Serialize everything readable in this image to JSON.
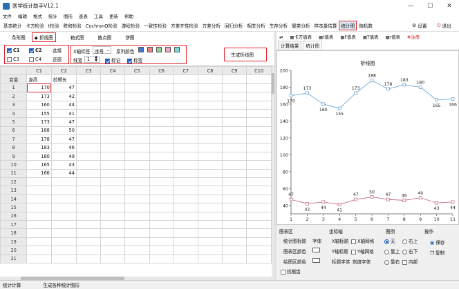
{
  "window": {
    "title": "医学统计助手V12.1",
    "minimize": "—",
    "maximize": "☐",
    "close": "✕"
  },
  "menu": [
    "文件",
    "编辑",
    "格式",
    "统计",
    "图形",
    "查表",
    "工具",
    "更新",
    "帮助"
  ],
  "modules": [
    "基本统计",
    "卡方检验",
    "t检验",
    "秩和检验",
    "CochranQ检验",
    "游程检验",
    "一致性检验",
    "方差齐性检验",
    "方差分析",
    "回归分析",
    "相关分析",
    "生存分析",
    "聚类分析",
    "样本量估算",
    "统计图",
    "随机数"
  ],
  "active_module": "统计图",
  "top_right": {
    "settings": "设置",
    "exit": "退出"
  },
  "left_tabs": [
    "条形图",
    "折线图",
    "箱式图",
    "散点图",
    "饼图"
  ],
  "active_left_tab": "折线图",
  "controls": {
    "c1": "C1",
    "c2": "C2",
    "c3": "C3",
    "c4": "C4",
    "select_btn": "选择",
    "restore_btn": "还原",
    "xaxis_label": "X轴标签",
    "xaxis_value": "序号",
    "series_color": "系列颜色",
    "colors": [
      "#3a7bd5",
      "#f08080",
      "#8fd18f",
      "#f4a6c8",
      "#7fd8d8"
    ],
    "linewidth_label": "线宽",
    "linewidth_value": "1",
    "marker": "标记",
    "label": "标签",
    "generate_btn": "生成折线图"
  },
  "grid": {
    "columns": [
      "",
      "C1",
      "C2",
      "C3",
      "C4",
      "C5",
      "C6",
      "C7",
      "C8",
      "C9",
      "C10"
    ],
    "header_row": [
      "变量",
      "身高",
      "前臂长"
    ],
    "rows": [
      {
        "n": "1",
        "c1": "170",
        "c2": "47"
      },
      {
        "n": "2",
        "c1": "173",
        "c2": "42"
      },
      {
        "n": "3",
        "c1": "160",
        "c2": "44"
      },
      {
        "n": "4",
        "c1": "155",
        "c2": "41"
      },
      {
        "n": "5",
        "c1": "173",
        "c2": "47"
      },
      {
        "n": "6",
        "c1": "188",
        "c2": "50"
      },
      {
        "n": "7",
        "c1": "178",
        "c2": "47"
      },
      {
        "n": "8",
        "c1": "183",
        "c2": "46"
      },
      {
        "n": "9",
        "c1": "180",
        "c2": "49"
      },
      {
        "n": "10",
        "c1": "165",
        "c2": "43"
      },
      {
        "n": "11",
        "c1": "166",
        "c2": "44"
      },
      {
        "n": "12",
        "c1": "",
        "c2": ""
      },
      {
        "n": "13",
        "c1": "",
        "c2": ""
      },
      {
        "n": "14",
        "c1": "",
        "c2": ""
      },
      {
        "n": "15",
        "c1": "",
        "c2": ""
      },
      {
        "n": "16",
        "c1": "",
        "c2": ""
      },
      {
        "n": "17",
        "c1": "",
        "c2": ""
      },
      {
        "n": "18",
        "c1": "",
        "c2": ""
      },
      {
        "n": "19",
        "c1": "",
        "c2": ""
      },
      {
        "n": "20",
        "c1": "",
        "c2": ""
      },
      {
        "n": "21",
        "c1": "",
        "c2": ""
      }
    ]
  },
  "right_toolbar": [
    "卡方值表",
    "t值表",
    "F值表",
    "T值表",
    "r值表",
    "注册"
  ],
  "right_tabs": [
    "计算结果",
    "统计图"
  ],
  "active_right_tab": "统计图",
  "options": {
    "chart_area": {
      "title": "图表区",
      "chart_title": "统计图标题",
      "font": "字体",
      "chart_bg": "图表区颜色",
      "plot_bg": "绘图区颜色",
      "antialias": "抗锯齿"
    },
    "axes": {
      "title": "坐标轴",
      "xtitle": "X轴标题",
      "ytitle": "Y轴标题",
      "xgrid": "X轴网格",
      "ygrid": "Y轴网格",
      "title_font": "标题字体",
      "tick_font": "刻度字体"
    },
    "legend": {
      "title": "图例",
      "none": "无",
      "top_right": "右上",
      "right": "靠上",
      "bottom_right": "右下",
      "left": "靠右",
      "inside": "内部"
    },
    "ops": {
      "title": "操作",
      "save": "保存",
      "copy": "复制"
    }
  },
  "status": {
    "left": "统计计算",
    "right": "生成各种统计图形"
  },
  "chart_data": {
    "type": "line",
    "title": "折线图",
    "x": [
      1,
      2,
      3,
      4,
      5,
      6,
      7,
      8,
      9,
      10,
      11
    ],
    "series": [
      {
        "values": [
          170,
          173,
          160,
          155,
          173,
          188,
          178,
          183,
          180,
          165,
          166
        ],
        "color": "#5b9bd5"
      },
      {
        "values": [
          47,
          42,
          44,
          41,
          47,
          50,
          47,
          46,
          49,
          43,
          44
        ],
        "color": "#c0607a"
      }
    ],
    "ylim": [
      30,
      200
    ],
    "yticks": [
      40,
      60,
      80,
      100,
      120,
      140,
      160,
      180,
      200
    ],
    "xlim": [
      1,
      11
    ],
    "grid": false,
    "legend": "none"
  }
}
